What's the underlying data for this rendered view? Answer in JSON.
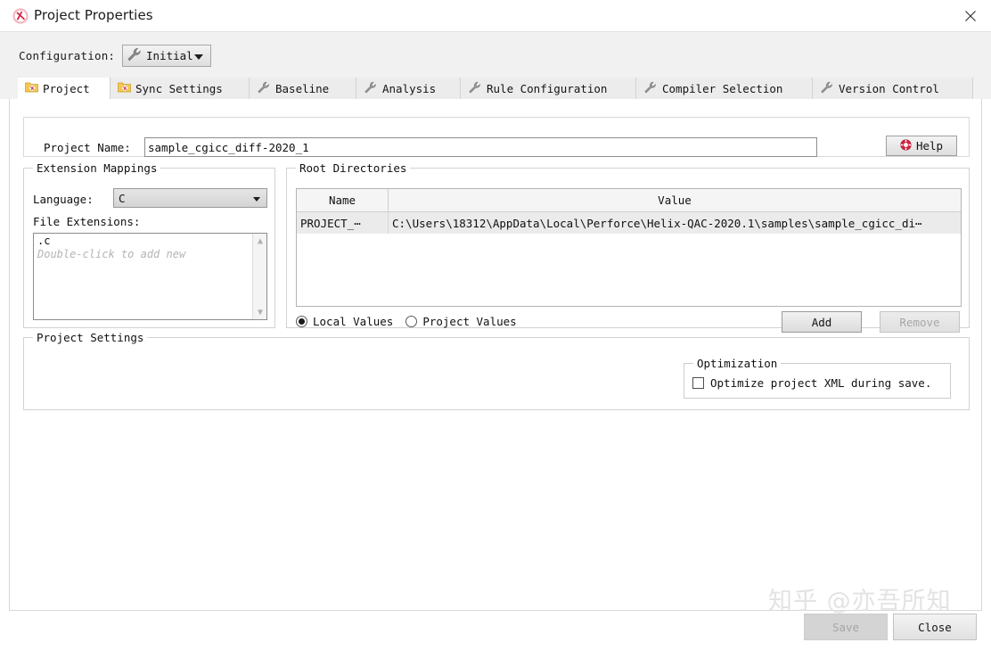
{
  "window": {
    "title": "Project Properties",
    "app_icon": "helix-qac-logo-icon",
    "close_label": "✕"
  },
  "config": {
    "label": "Configuration:",
    "selected": "Initial",
    "icon": "wrench-icon"
  },
  "tabs": [
    {
      "label": "Project",
      "icon": "project-folder-icon",
      "active": true
    },
    {
      "label": "Sync Settings",
      "icon": "project-folder-icon",
      "active": false
    },
    {
      "label": "Baseline",
      "icon": "wrench-icon",
      "active": false
    },
    {
      "label": "Analysis",
      "icon": "wrench-icon",
      "active": false
    },
    {
      "label": "Rule Configuration",
      "icon": "wrench-icon",
      "active": false
    },
    {
      "label": "Compiler Selection",
      "icon": "wrench-icon",
      "active": false
    },
    {
      "label": "Version Control",
      "icon": "wrench-icon",
      "active": false
    }
  ],
  "project_name": {
    "label": "Project Name:",
    "value": "sample_cgicc_diff-2020_1",
    "placeholder": ""
  },
  "help": {
    "label": "Help",
    "icon": "lifebuoy-help-icon"
  },
  "extension_mappings": {
    "legend": "Extension Mappings",
    "language_label": "Language:",
    "language_value": "C",
    "file_extensions_label": "File Extensions:",
    "items": [
      ".c"
    ],
    "hint": "Double-click to add new"
  },
  "root_directories": {
    "legend": "Root Directories",
    "columns": [
      "Name",
      "Value"
    ],
    "rows": [
      {
        "name": "PROJECT_⋯",
        "value": "C:\\Users\\18312\\AppData\\Local\\Perforce\\Helix-QAC-2020.1\\samples\\sample_cgicc_di⋯"
      }
    ],
    "radios": [
      {
        "label": "Local Values",
        "selected": true
      },
      {
        "label": "Project Values",
        "selected": false
      }
    ],
    "add_label": "Add",
    "remove_label": "Remove",
    "remove_disabled": true
  },
  "project_settings": {
    "legend": "Project Settings",
    "optimization": {
      "legend": "Optimization",
      "checkbox_label": "Optimize project XML during save.",
      "checked": false
    }
  },
  "footer": {
    "save_label": "Save",
    "save_disabled": true,
    "close_label": "Close"
  },
  "watermark": "知乎 @亦吾所知",
  "colors": {
    "accent_red": "#d6213f",
    "folder_yellow": "#f4c84b",
    "chrome_gray": "#f1f1f1"
  }
}
